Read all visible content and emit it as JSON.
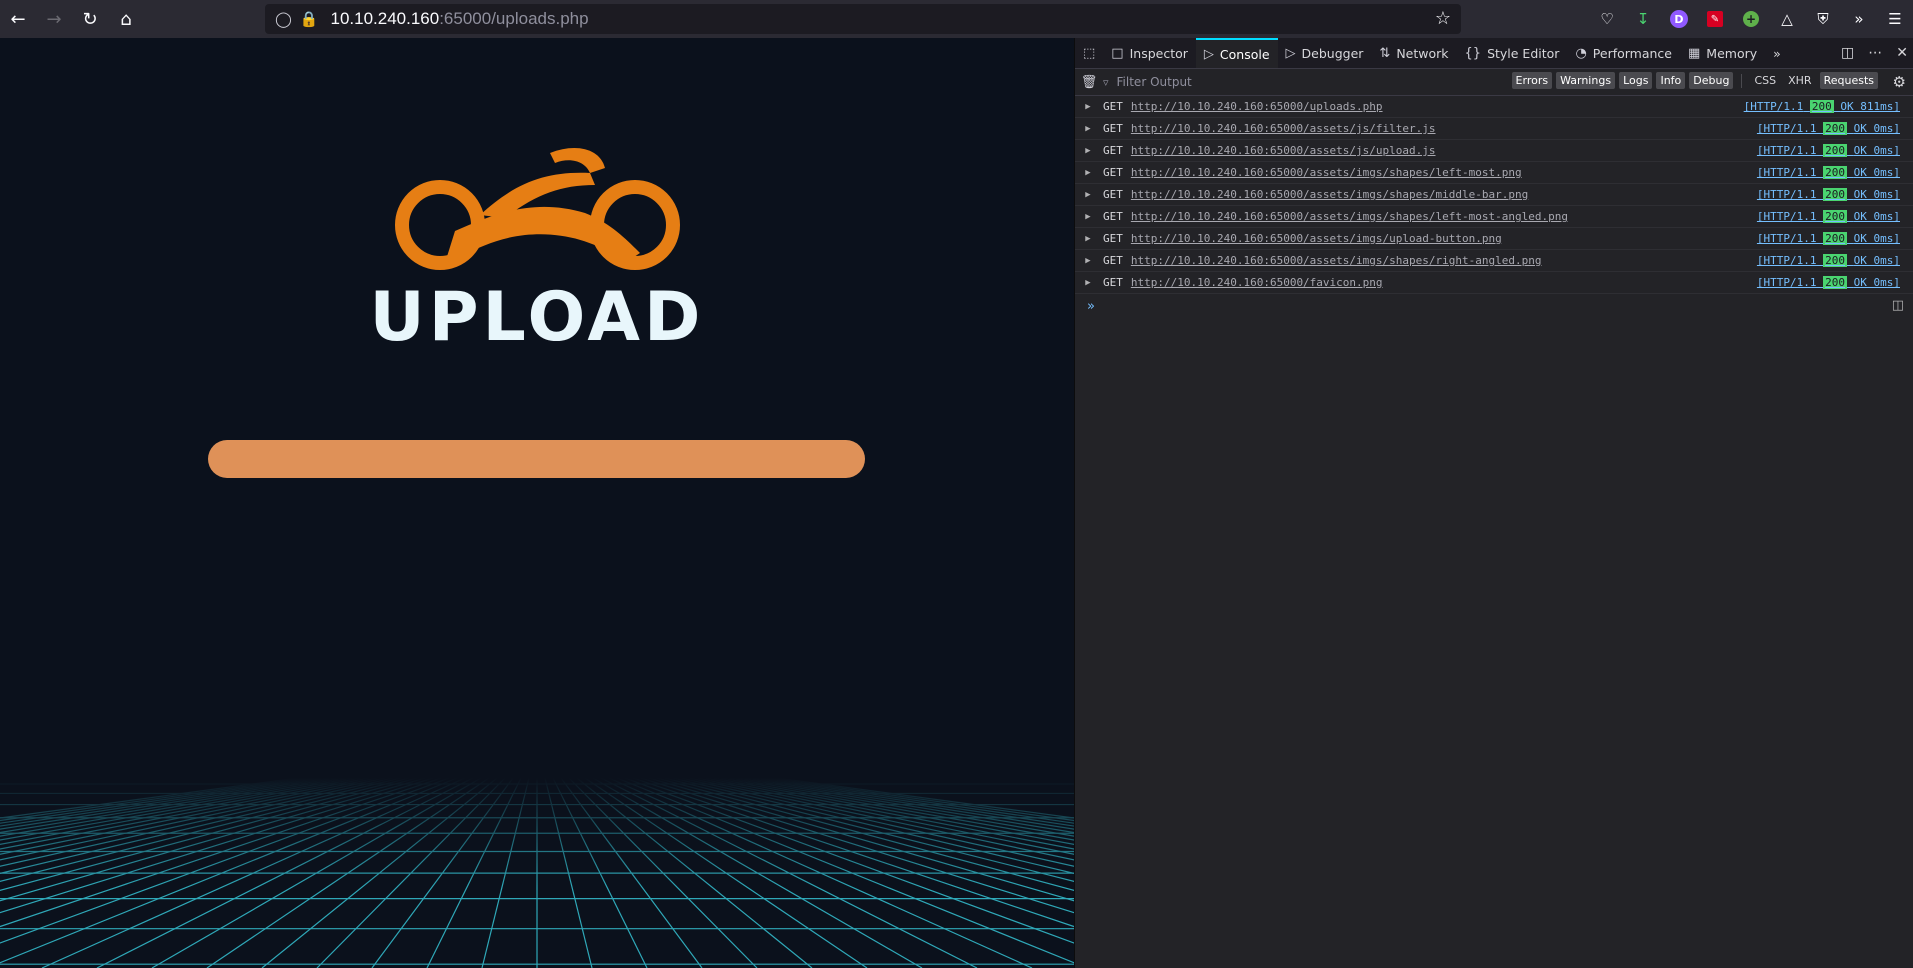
{
  "browser": {
    "url_host": "10.10.240.160",
    "url_path": ":65000/uploads.php",
    "profile_letter": "D"
  },
  "page": {
    "logo_text": "UPLOAD"
  },
  "devtools": {
    "tabs": [
      "Inspector",
      "Console",
      "Debugger",
      "Network",
      "Style Editor",
      "Performance",
      "Memory"
    ],
    "active_tab": "Console",
    "filter_placeholder": "Filter Output",
    "filter_buttons": [
      "Errors",
      "Warnings",
      "Logs",
      "Info",
      "Debug"
    ],
    "extra_buttons": [
      "CSS",
      "XHR",
      "Requests"
    ],
    "requests": [
      {
        "method": "GET",
        "url": "http://10.10.240.160:65000/uploads.php",
        "proto": "[HTTP/1.1",
        "code": "200",
        "tail": "OK 811ms]"
      },
      {
        "method": "GET",
        "url": "http://10.10.240.160:65000/assets/js/filter.js",
        "proto": "[HTTP/1.1",
        "code": "200",
        "tail": "OK 0ms]"
      },
      {
        "method": "GET",
        "url": "http://10.10.240.160:65000/assets/js/upload.js",
        "proto": "[HTTP/1.1",
        "code": "200",
        "tail": "OK 0ms]"
      },
      {
        "method": "GET",
        "url": "http://10.10.240.160:65000/assets/imgs/shapes/left-most.png",
        "proto": "[HTTP/1.1",
        "code": "200",
        "tail": "OK 0ms]"
      },
      {
        "method": "GET",
        "url": "http://10.10.240.160:65000/assets/imgs/shapes/middle-bar.png",
        "proto": "[HTTP/1.1",
        "code": "200",
        "tail": "OK 0ms]"
      },
      {
        "method": "GET",
        "url": "http://10.10.240.160:65000/assets/imgs/shapes/left-most-angled.png",
        "proto": "[HTTP/1.1",
        "code": "200",
        "tail": "OK 0ms]"
      },
      {
        "method": "GET",
        "url": "http://10.10.240.160:65000/assets/imgs/upload-button.png",
        "proto": "[HTTP/1.1",
        "code": "200",
        "tail": "OK 0ms]"
      },
      {
        "method": "GET",
        "url": "http://10.10.240.160:65000/assets/imgs/shapes/right-angled.png",
        "proto": "[HTTP/1.1",
        "code": "200",
        "tail": "OK 0ms]"
      },
      {
        "method": "GET",
        "url": "http://10.10.240.160:65000/favicon.png",
        "proto": "[HTTP/1.1",
        "code": "200",
        "tail": "OK 0ms]"
      }
    ]
  }
}
